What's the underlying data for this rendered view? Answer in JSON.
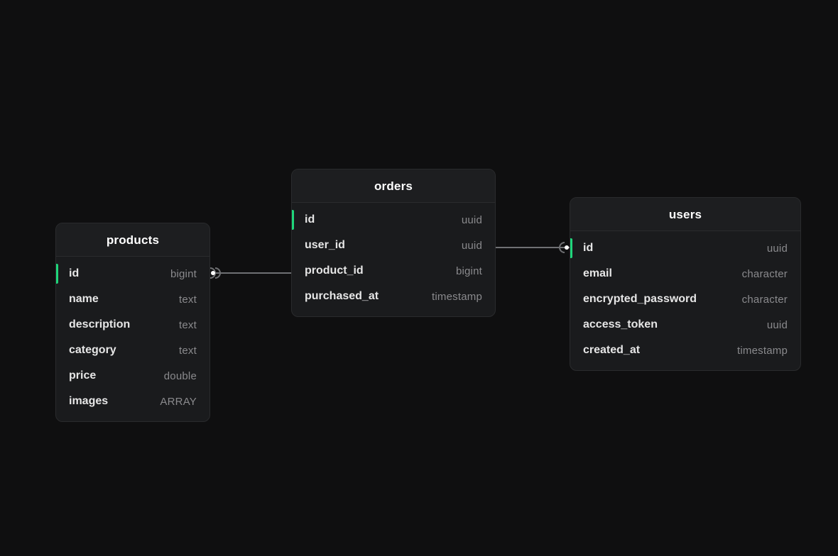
{
  "tables": {
    "products": {
      "title": "products",
      "fields": [
        {
          "name": "id",
          "type": "bigint",
          "pk": true
        },
        {
          "name": "name",
          "type": "text"
        },
        {
          "name": "description",
          "type": "text"
        },
        {
          "name": "category",
          "type": "text"
        },
        {
          "name": "price",
          "type": "double"
        },
        {
          "name": "images",
          "type": "ARRAY"
        }
      ]
    },
    "orders": {
      "title": "orders",
      "fields": [
        {
          "name": "id",
          "type": "uuid",
          "pk": true
        },
        {
          "name": "user_id",
          "type": "uuid"
        },
        {
          "name": "product_id",
          "type": "bigint"
        },
        {
          "name": "purchased_at",
          "type": "timestamp"
        }
      ]
    },
    "users": {
      "title": "users",
      "fields": [
        {
          "name": "id",
          "type": "uuid",
          "pk": true
        },
        {
          "name": "email",
          "type": "character"
        },
        {
          "name": "encrypted_password",
          "type": "character"
        },
        {
          "name": "access_token",
          "type": "uuid"
        },
        {
          "name": "created_at",
          "type": "timestamp"
        }
      ]
    }
  },
  "relations": [
    {
      "from_table": "orders",
      "from_field": "product_id",
      "to_table": "products",
      "to_field": "id"
    },
    {
      "from_table": "orders",
      "from_field": "user_id",
      "to_table": "users",
      "to_field": "id"
    }
  ],
  "colors": {
    "accent": "#1fd67b",
    "card_bg": "#1a1b1d",
    "canvas_bg": "#0f0f10",
    "connection": "#6f7073"
  }
}
